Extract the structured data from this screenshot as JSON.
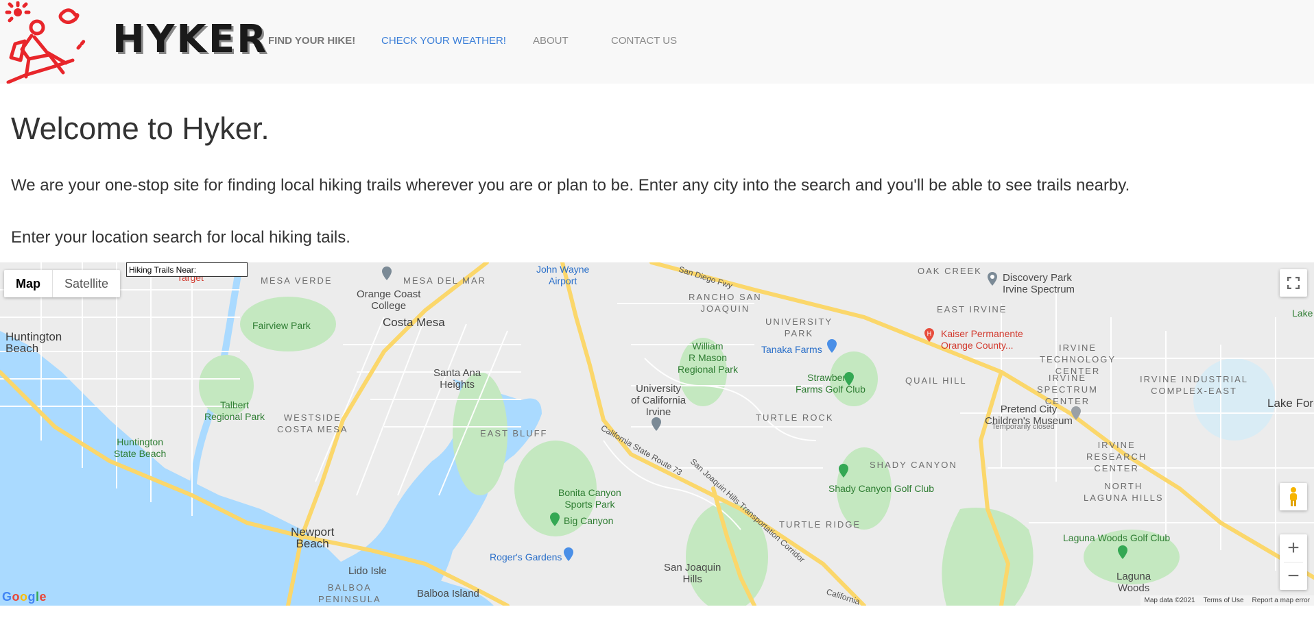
{
  "nav": {
    "brand": "HYKER",
    "links": [
      {
        "label": "FIND YOUR HIKE!"
      },
      {
        "label": "CHECK YOUR WEATHER!"
      },
      {
        "label": "ABOUT"
      },
      {
        "label": "CONTACT US"
      }
    ]
  },
  "main": {
    "title": "Welcome to Hyker.",
    "intro": "We are your one-stop site for finding local hiking trails wherever you are or plan to be. Enter any city into the search and you'll be able to see trails nearby.",
    "prompt": "Enter your location search for local hiking tails."
  },
  "map": {
    "type_map": "Map",
    "type_satellite": "Satellite",
    "search_placeholder": "Hiking Trails Near:",
    "attribution": "Map data ©2021",
    "terms": "Terms of Use",
    "report": "Report a map error",
    "google": "Google",
    "colors": {
      "water": "#aadaff",
      "park": "#c4e8c0",
      "highway": "#fbd76b",
      "land": "#ececec"
    },
    "labels": {
      "huntington_beach": "Huntington\nBeach",
      "huntington_state_beach": "Huntington\nState Beach",
      "talbert_park": "Talbert\nRegional Park",
      "fairview_park": "Fairview Park",
      "westside": "WESTSIDE\nCOSTA MESA",
      "mesa_del_mar": "MESA DEL MAR",
      "mesa_verde": "MESA VERDE",
      "orange_coast": "Orange Coast\nCollege",
      "costa_mesa": "Costa Mesa",
      "santa_ana_heights": "Santa Ana\nHeights",
      "east_bluff": "EAST BLUFF",
      "newport_beach": "Newport\nBeach",
      "lido_isle": "Lido Isle",
      "balboa_peninsula": "BALBOA\nPENINSULA",
      "balboa_island": "Balboa Island",
      "john_wayne": "John Wayne\nAirport",
      "rancho": "RANCHO SAN\nJOAQUIN",
      "mason_park": "William\nR Mason\nRegional Park",
      "uci": "University\nof California\nIrvine",
      "university_park": "UNIVERSITY\nPARK",
      "tanaka": "Tanaka Farms",
      "strawberry": "Strawberry\nFarms Golf Club",
      "turtle_rock": "TURTLE ROCK",
      "shady_canyon": "SHADY CANYON",
      "shady_golf": "Shady Canyon Golf Club",
      "turtle_ridge": "TURTLE RIDGE",
      "bonita": "Bonita Canyon\nSports Park",
      "big_canyon": "Big Canyon",
      "rogers": "Roger's Gardens",
      "san_joaquin_hills": "San Joaquin\nHills",
      "oak_creek": "OAK CREEK",
      "east_irvine": "EAST IRVINE",
      "discovery": "Discovery Park\nIrvine Spectrum",
      "kaiser": "Kaiser Permanente\nOrange County...",
      "quail_hill": "QUAIL HILL",
      "irvine_tech": "IRVINE\nTECHNOLOGY\nCENTER",
      "irvine_spectrum": "IRVINE\nSPECTRUM\nCENTER",
      "irvine_industrial": "IRVINE INDUSTRIAL\nCOMPLEX-EAST",
      "pretend_city": "Pretend City\nChildren's Museum",
      "temp_closed": "Temporarily closed",
      "irvine_research": "IRVINE\nRESEARCH\nCENTER",
      "north_laguna": "NORTH\nLAGUNA HILLS",
      "laguna_woods_golf": "Laguna Woods Golf Club",
      "laguna_woods": "Laguna\nWoods",
      "lake_forest": "Lake Fores",
      "lake": "Lake",
      "target": "Target",
      "sd_fwy": "San Diego Fwy",
      "ca73": "California State Route 73",
      "sjh_corridor": "San Joaquin Hills Transportation Corridor",
      "california": "California"
    }
  }
}
